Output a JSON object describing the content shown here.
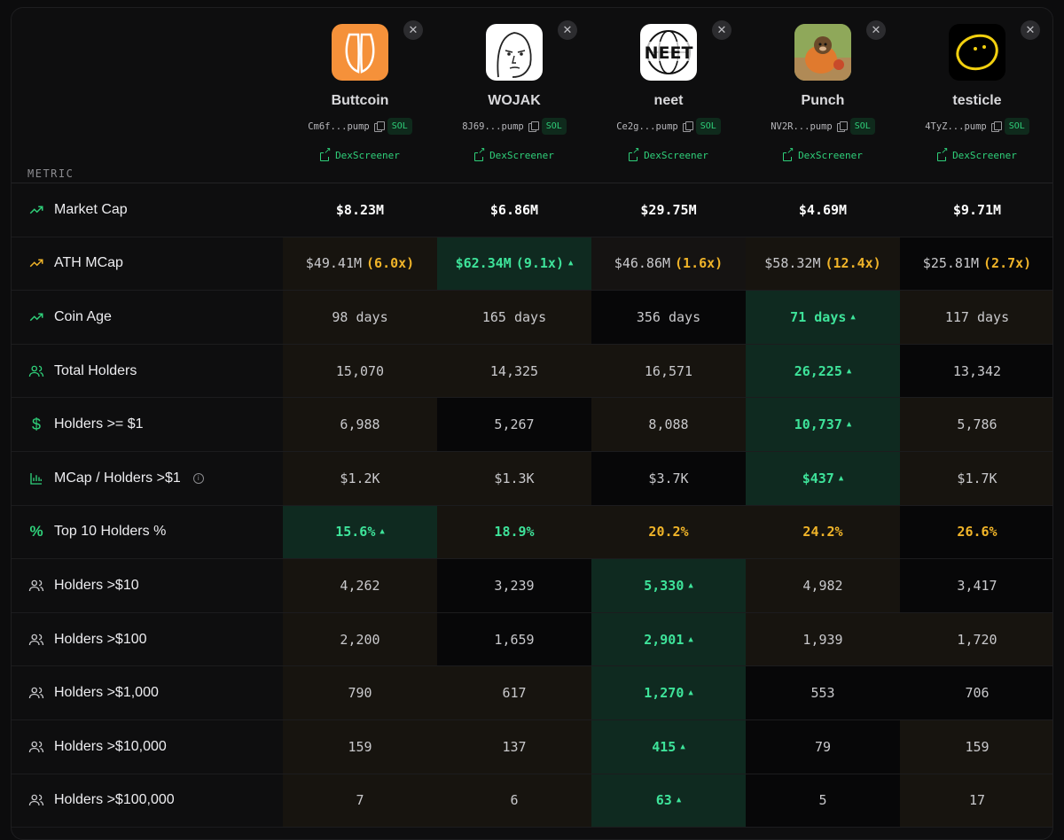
{
  "header": {
    "metric_label": "METRIC"
  },
  "coins": [
    {
      "name": "Buttcoin",
      "address": "Cm6f...pump",
      "chain": "SOL",
      "dex_label": "DexScreener",
      "logo": "buttcoin-logo"
    },
    {
      "name": "WOJAK",
      "address": "8J69...pump",
      "chain": "SOL",
      "dex_label": "DexScreener",
      "logo": "wojak-logo"
    },
    {
      "name": "neet",
      "address": "Ce2g...pump",
      "chain": "SOL",
      "dex_label": "DexScreener",
      "logo": "neet-logo"
    },
    {
      "name": "Punch",
      "address": "NV2R...pump",
      "chain": "SOL",
      "dex_label": "DexScreener",
      "logo": "punch-logo"
    },
    {
      "name": "testicle",
      "address": "4TyZ...pump",
      "chain": "SOL",
      "dex_label": "DexScreener",
      "logo": "testicle-logo"
    }
  ],
  "rows": [
    {
      "label": "Market Cap",
      "icon": "trending-up-icon",
      "icon_color": "#2fd07a",
      "values": [
        "$8.23M",
        "$6.86M",
        "$29.75M",
        "$4.69M",
        "$9.71M"
      ]
    },
    {
      "label": "ATH MCap",
      "icon": "trending-up-icon",
      "icon_color": "#f0b429",
      "values": [
        "$49.41M",
        "$62.34M",
        "$46.86M",
        "$58.32M",
        "$25.81M"
      ],
      "multipliers": [
        "(6.0x)",
        "(9.1x)",
        "(1.6x)",
        "(12.4x)",
        "(2.7x)"
      ]
    },
    {
      "label": "Coin Age",
      "icon": "trending-up-icon",
      "icon_color": "#2fd07a",
      "values": [
        "98 days",
        "165 days",
        "356 days",
        "71 days",
        "117 days"
      ]
    },
    {
      "label": "Total Holders",
      "icon": "users-icon",
      "icon_color": "#2fd07a",
      "values": [
        "15,070",
        "14,325",
        "16,571",
        "26,225",
        "13,342"
      ]
    },
    {
      "label": "Holders >= $1",
      "icon": "dollar-icon",
      "icon_color": "#2fd07a",
      "values": [
        "6,988",
        "5,267",
        "8,088",
        "10,737",
        "5,786"
      ]
    },
    {
      "label": "MCap / Holders >$1",
      "icon": "bar-chart-icon",
      "icon_color": "#2fd07a",
      "values": [
        "$1.2K",
        "$1.3K",
        "$3.7K",
        "$437",
        "$1.7K"
      ]
    },
    {
      "label": "Top 10 Holders %",
      "icon": "percent-icon",
      "icon_color": "#2fd07a",
      "values": [
        "15.6%",
        "18.9%",
        "20.2%",
        "24.2%",
        "26.6%"
      ]
    },
    {
      "label": "Holders >$10",
      "icon": "users-icon",
      "icon_color": "#c9c9cc",
      "values": [
        "4,262",
        "3,239",
        "5,330",
        "4,982",
        "3,417"
      ]
    },
    {
      "label": "Holders >$100",
      "icon": "users-icon",
      "icon_color": "#c9c9cc",
      "values": [
        "2,200",
        "1,659",
        "2,901",
        "1,939",
        "1,720"
      ]
    },
    {
      "label": "Holders >$1,000",
      "icon": "users-icon",
      "icon_color": "#c9c9cc",
      "values": [
        "790",
        "617",
        "1,270",
        "553",
        "706"
      ]
    },
    {
      "label": "Holders >$10,000",
      "icon": "users-icon",
      "icon_color": "#c9c9cc",
      "values": [
        "159",
        "137",
        "415",
        "79",
        "159"
      ]
    },
    {
      "label": "Holders >$100,000",
      "icon": "users-icon",
      "icon_color": "#c9c9cc",
      "values": [
        "7",
        "6",
        "63",
        "5",
        "17"
      ]
    }
  ],
  "colors": {
    "good": "#3ee39a",
    "warn": "#f0b429",
    "good_bg": "#0f2a20"
  }
}
